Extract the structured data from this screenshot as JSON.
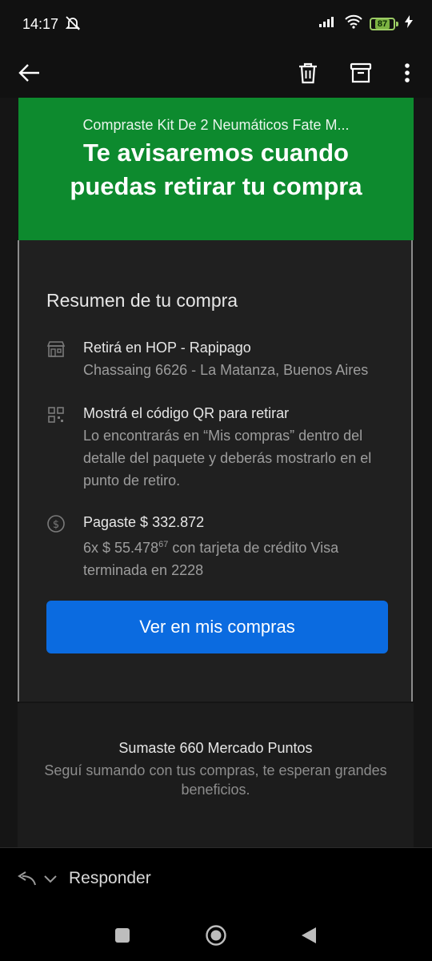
{
  "status_bar": {
    "time": "14:17",
    "battery_level": "87"
  },
  "banner": {
    "subtitle": "Compraste Kit De 2 Neumáticos Fate M...",
    "title": "Te avisaremos cuando puedas retirar tu compra"
  },
  "summary": {
    "heading": "Resumen de tu compra",
    "items": [
      {
        "icon": "store-icon",
        "title": "Retirá en HOP - Rapipago",
        "body": "Chassaing 6626 - La Matanza, Buenos Aires"
      },
      {
        "icon": "qr-code-icon",
        "title": "Mostrá el código QR para retirar",
        "body": "Lo encontrarás en “Mis compras” dentro del detalle del paquete y deberás mostrarlo en el punto de retiro."
      },
      {
        "icon": "dollar-icon",
        "title": "Pagaste $ 332.872",
        "body_prefix": "6x $ 55.478",
        "body_cents": "67",
        "body_suffix": " con tarjeta de crédito Visa terminada en 2228"
      }
    ],
    "button_label": "Ver en mis compras"
  },
  "points": {
    "title": "Sumaste 660 Mercado Puntos",
    "body": "Seguí sumando con tus compras, te esperan grandes beneficios."
  },
  "reply": {
    "label": "Responder"
  },
  "colors": {
    "banner_green": "#0d8a2e",
    "primary_blue": "#0b6be0",
    "background": "#181818"
  }
}
